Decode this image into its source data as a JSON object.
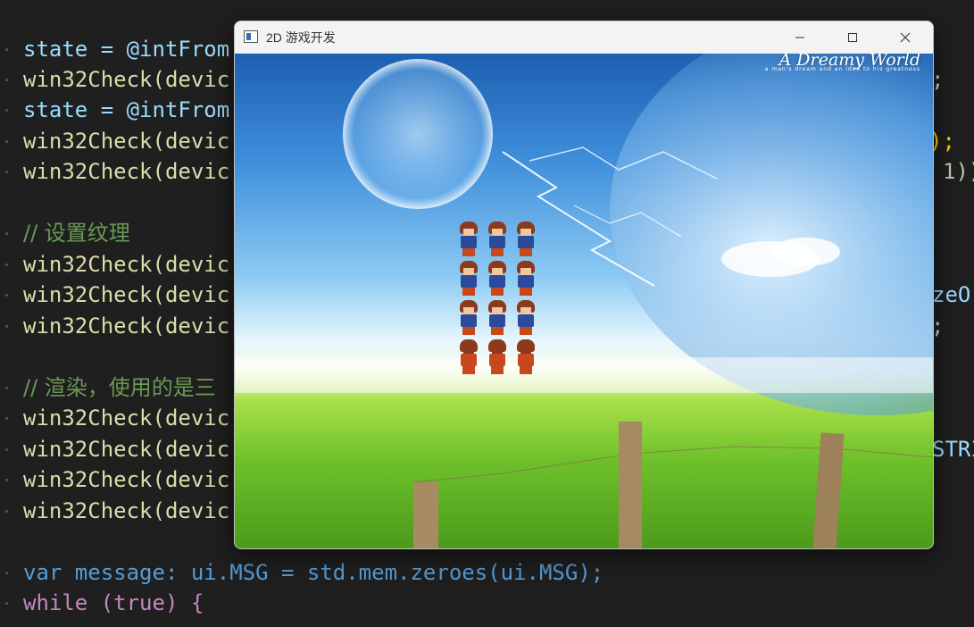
{
  "editor": {
    "lines": {
      "l1": "state = @intFrom",
      "l2": "win32Check(devic",
      "l3": "state = @intFrom",
      "l4": "win32Check(devic",
      "l5": "win32Check(devic",
      "c1": "// 设置纹理",
      "l7": "win32Check(devic",
      "l8": "win32Check(devic",
      "l9": "win32Check(devic",
      "c2": "// 渲染，使用的是三",
      "l11": "win32Check(devic",
      "l12": "win32Check(devic",
      "l13": "win32Check(devic",
      "l14": "win32Check(devic",
      "l15": "var message: ui.MSG = std.mem.zeroes(ui.MSG);",
      "l16": "while (true) {"
    },
    "right": {
      "r2": ";",
      "r4": ");",
      "r5": "1));",
      "r8": "zeO-",
      "r9": ";",
      "r12": "STRI"
    }
  },
  "window": {
    "title": "2D 游戏开发",
    "brand": "A Dreamy World",
    "tagline": "a man's dream and an idea to his greatness"
  }
}
